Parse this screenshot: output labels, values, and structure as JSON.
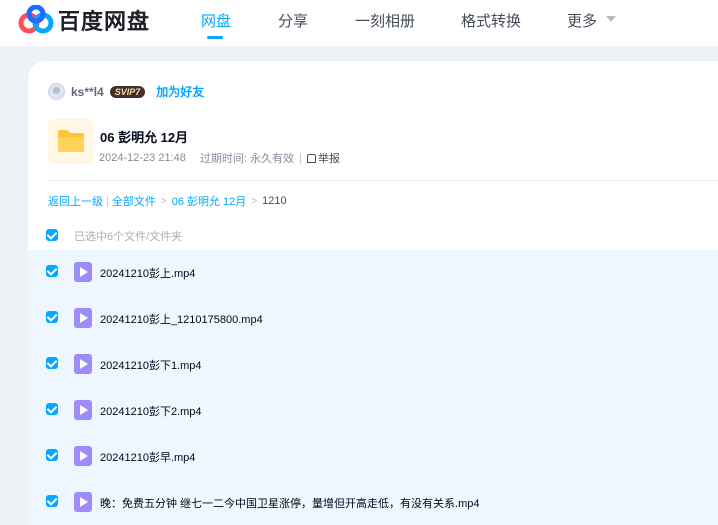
{
  "brand": {
    "logo_text": "百度网盘",
    "accent": "#06a7ff"
  },
  "nav": {
    "items": [
      {
        "label": "网盘",
        "active": true
      },
      {
        "label": "分享",
        "active": false
      },
      {
        "label": "一刻相册",
        "active": false
      },
      {
        "label": "格式转换",
        "active": false
      },
      {
        "label": "更多",
        "active": false
      }
    ]
  },
  "sharer": {
    "username": "ks**l4",
    "badge": "SVIP7",
    "add_friend": "加为好友"
  },
  "folder": {
    "title": "06 彭明允 12月",
    "date": "2024-12-23 21:48",
    "expiry_label": "过期时间: 永久有效",
    "report": "举报",
    "icon": "folder-icon"
  },
  "breadcrumb": {
    "back": "返回上一级",
    "all_files": "全部文件",
    "parent": "06 彭明允 12月",
    "current": "1210"
  },
  "selection": {
    "summary": "已选中6个文件/文件夹"
  },
  "files": [
    {
      "name": "20241210彭上.mp4",
      "checked": true,
      "icon": "video-icon"
    },
    {
      "name": "20241210彭上_1210175800.mp4",
      "checked": true,
      "icon": "video-icon"
    },
    {
      "name": "20241210彭下1.mp4",
      "checked": true,
      "icon": "video-icon"
    },
    {
      "name": "20241210彭下2.mp4",
      "checked": true,
      "icon": "video-icon"
    },
    {
      "name": "20241210彭早.mp4",
      "checked": true,
      "icon": "video-icon"
    },
    {
      "name": "晚：免费五分钟 继七一二今中国卫星涨停，量增但开高走低，有没有关系.mp4",
      "checked": true,
      "icon": "video-icon"
    }
  ]
}
